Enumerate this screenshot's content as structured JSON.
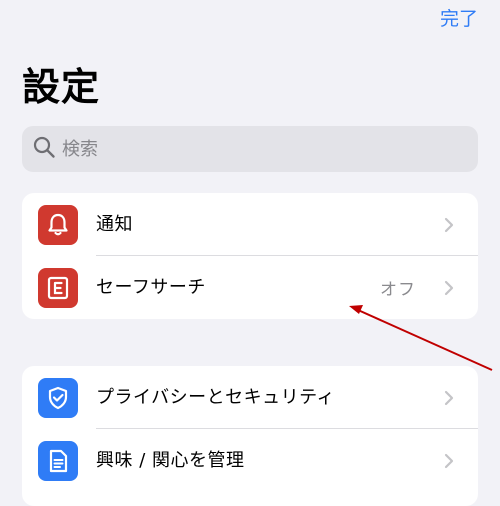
{
  "header": {
    "done_label": "完了",
    "title": "設定"
  },
  "search": {
    "placeholder": "検索"
  },
  "groups": [
    {
      "rows": [
        {
          "label": "通知",
          "icon": "bell-icon",
          "icon_color": "#d0392f"
        },
        {
          "label": "セーフサーチ",
          "value": "オフ",
          "icon": "safesearch-e-icon",
          "icon_color": "#d0392f"
        }
      ]
    },
    {
      "rows": [
        {
          "label": "プライバシーとセキュリティ",
          "icon": "shield-check-icon",
          "icon_color": "#2f7cf6"
        },
        {
          "label": "興味 / 関心を管理",
          "icon": "document-icon",
          "icon_color": "#2f7cf6"
        }
      ]
    }
  ],
  "colors": {
    "accent": "#2f7cf6",
    "red": "#d0392f",
    "background": "#f2f2f7",
    "annotation_arrow": "#c00000"
  }
}
